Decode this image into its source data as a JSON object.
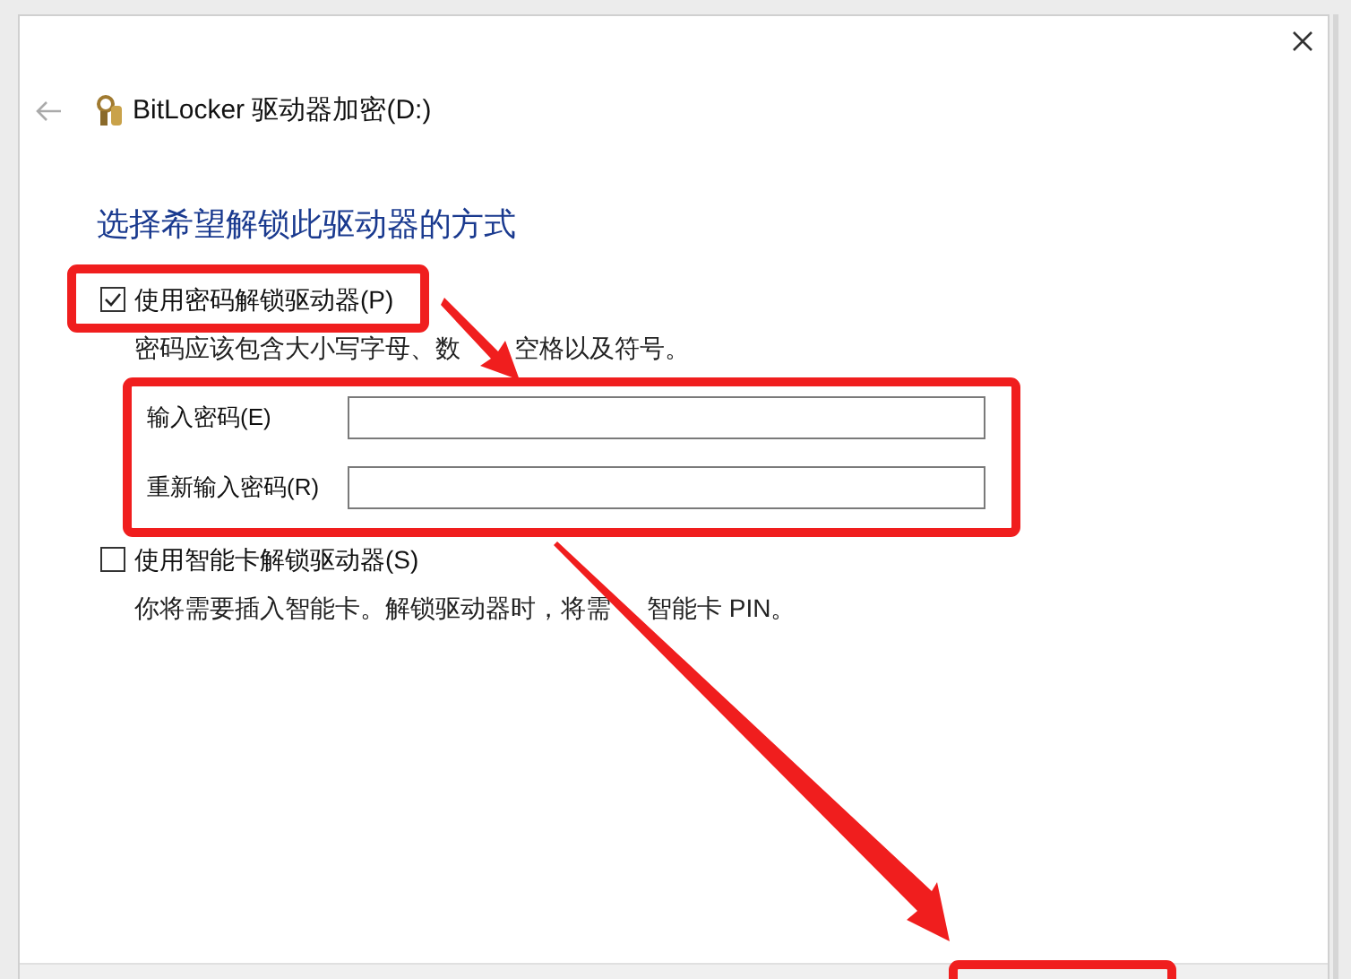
{
  "window": {
    "title": "BitLocker 驱动器加密(D:)"
  },
  "heading": "选择希望解锁此驱动器的方式",
  "options": [
    {
      "label": "使用密码解锁驱动器(P)",
      "checked": true,
      "description": [
        "密码应该包含大小写字母、数",
        "空格以及符号。"
      ],
      "fields": [
        {
          "label": "输入密码(E)"
        },
        {
          "label": "重新输入密码(R)"
        }
      ]
    },
    {
      "label": "使用智能卡解锁驱动器(S)",
      "checked": false,
      "description": [
        "你将需要插入智能卡。解锁驱动器时，将需",
        "智能卡 PIN。"
      ]
    }
  ]
}
